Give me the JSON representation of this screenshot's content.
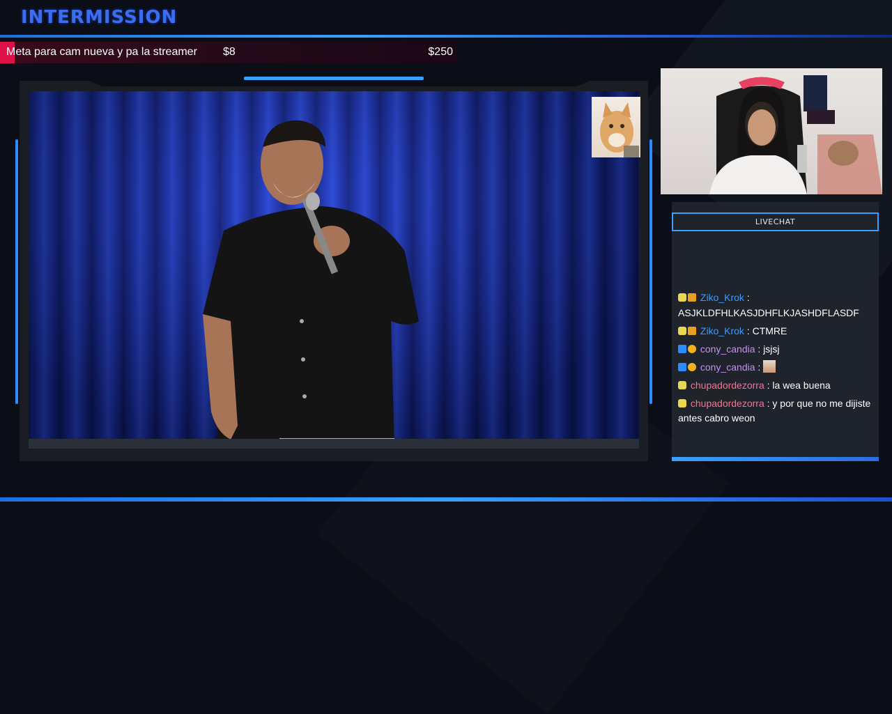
{
  "overlay": {
    "title": "INTERMISSION"
  },
  "goal": {
    "label": "Meta para cam nueva y pa la streamer",
    "current": "$8",
    "target": "$250",
    "progress_fraction": 0.032,
    "fill_color": "#e0104a"
  },
  "chat": {
    "header": "LIVECHAT",
    "messages": [
      {
        "user": "Ziko_Krok",
        "color": "#3a9cff",
        "badges": [
          "cat-badge",
          "crown-badge"
        ],
        "text": "ASJKLDFHLKASJDHFLKJASHDFLASDF",
        "emote": ""
      },
      {
        "user": "Ziko_Krok",
        "color": "#3a9cff",
        "badges": [
          "cat-badge",
          "crown-badge"
        ],
        "text": "CTMRE",
        "emote": ""
      },
      {
        "user": "cony_candia",
        "color": "#c890f0",
        "badges": [
          "prime-badge",
          "one-badge"
        ],
        "text": "jsjsj",
        "emote": ""
      },
      {
        "user": "cony_candia",
        "color": "#c890f0",
        "badges": [
          "prime-badge",
          "one-badge"
        ],
        "text": "",
        "emote": "face-emote"
      },
      {
        "user": "chupadordezorra",
        "color": "#ff7090",
        "badges": [
          "cat-badge"
        ],
        "text": "la wea buena",
        "emote": ""
      },
      {
        "user": "chupadordezorra",
        "color": "#ff7090",
        "badges": [
          "cat-badge"
        ],
        "text": "y por que no me dijiste antes cabro weon",
        "emote": ""
      }
    ]
  },
  "colors": {
    "accent": "#3aa0ff",
    "title": "#3a6df0",
    "background": "#0b0e16"
  }
}
